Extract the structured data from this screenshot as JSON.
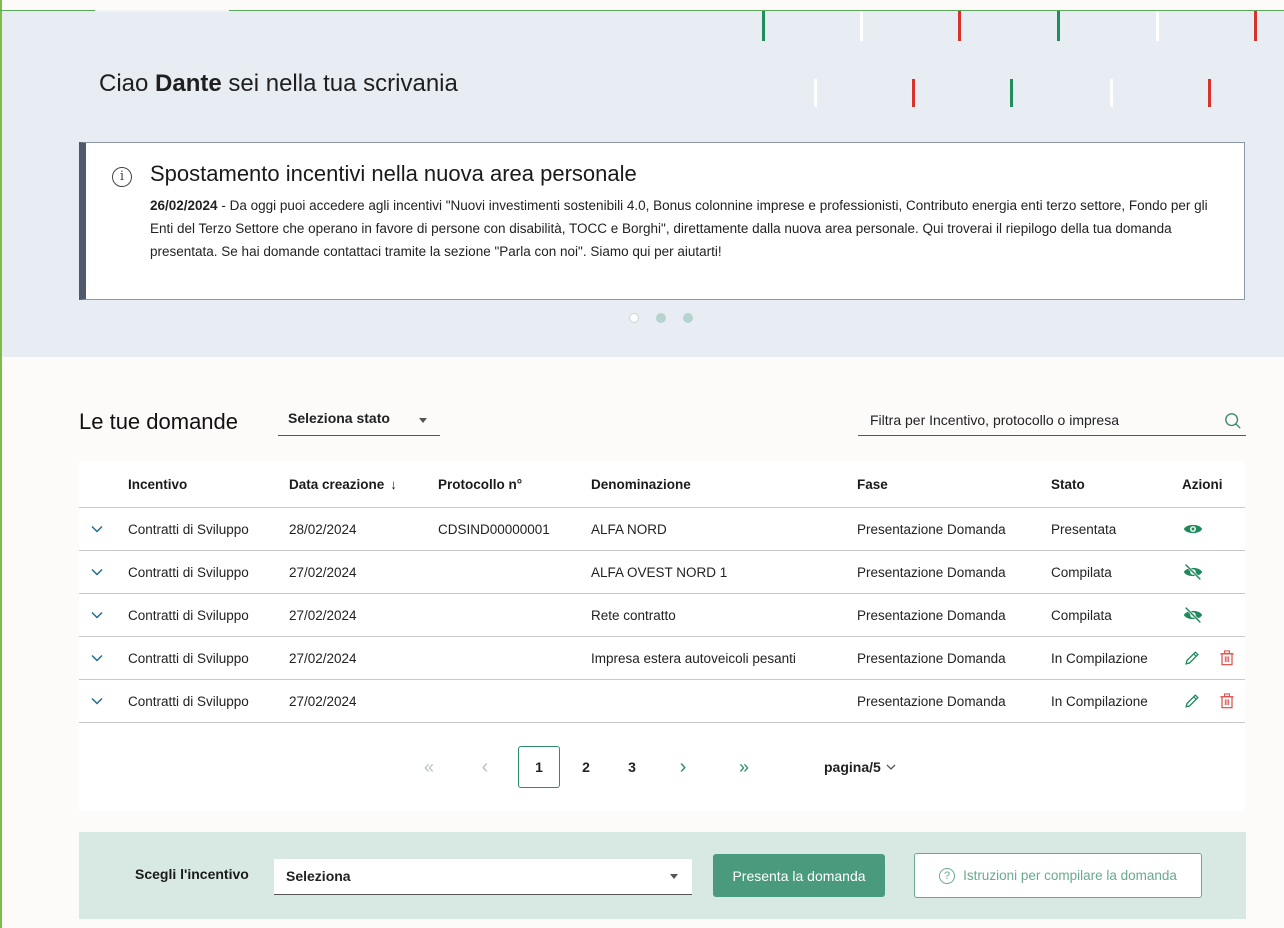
{
  "greeting": {
    "prefix": "Ciao",
    "name": "Dante",
    "suffix": "sei nella tua scrivania"
  },
  "notice": {
    "title": "Spostamento incentivi nella nuova area personale",
    "date": "26/02/2024",
    "body": " - Da oggi puoi accedere agli incentivi \"Nuovi investimenti sostenibili 4.0, Bonus colonnine imprese e professionisti, Contributo energia enti terzo settore, Fondo per gli Enti del Terzo Settore che operano in favore di persone con disabilità, TOCC e Borghi\", direttamente dalla nuova area personale. Qui troverai il riepilogo della tua domanda presentata. Se hai domande contattaci tramite la sezione \"Parla con noi\". Siamo qui per aiutarti!",
    "icon": "info-icon"
  },
  "section": {
    "title": "Le tue domande",
    "status_select": "Seleziona stato",
    "filter_placeholder": "Filtra per Incentivo, protocollo o impresa"
  },
  "table": {
    "headers": {
      "incentivo": "Incentivo",
      "data": "Data creazione",
      "protocollo": "Protocollo n°",
      "denominazione": "Denominazione",
      "fase": "Fase",
      "stato": "Stato",
      "azioni": "Azioni"
    },
    "rows": [
      {
        "incentivo": "Contratti di Sviluppo",
        "data": "28/02/2024",
        "protocollo": "CDSIND00000001",
        "denominazione": "ALFA NORD",
        "fase": "Presentazione Domanda",
        "stato": "Presentata",
        "actions": [
          "view-icon"
        ]
      },
      {
        "incentivo": "Contratti di Sviluppo",
        "data": "27/02/2024",
        "protocollo": "",
        "denominazione": "ALFA OVEST NORD 1",
        "fase": "Presentazione Domanda",
        "stato": "Compilata",
        "actions": [
          "view-off-icon"
        ]
      },
      {
        "incentivo": "Contratti di Sviluppo",
        "data": "27/02/2024",
        "protocollo": "",
        "denominazione": "Rete contratto",
        "fase": "Presentazione Domanda",
        "stato": "Compilata",
        "actions": [
          "view-off-icon"
        ]
      },
      {
        "incentivo": "Contratti di Sviluppo",
        "data": "27/02/2024",
        "protocollo": "",
        "denominazione": "Impresa estera autoveicoli pesanti",
        "fase": "Presentazione Domanda",
        "stato": "In Compilazione",
        "actions": [
          "edit-icon",
          "trash-icon"
        ]
      },
      {
        "incentivo": "Contratti di Sviluppo",
        "data": "27/02/2024",
        "protocollo": "",
        "denominazione": "",
        "fase": "Presentazione Domanda",
        "stato": "In Compilazione",
        "actions": [
          "edit-icon",
          "trash-icon"
        ]
      }
    ]
  },
  "pagination": {
    "first": "«",
    "prev": "‹",
    "pages": [
      "1",
      "2",
      "3"
    ],
    "current": "1",
    "next": "›",
    "last": "»",
    "page_of": "pagina/5"
  },
  "bottom": {
    "label": "Scegli l'incentivo",
    "select_value": "Seleziona",
    "submit": "Presenta la domanda",
    "help": "Istruzioni per compilare la domanda"
  },
  "colors": {
    "accent": "#4a9b7d",
    "danger": "#d9534f",
    "brand_green": "#1f8a5c"
  }
}
